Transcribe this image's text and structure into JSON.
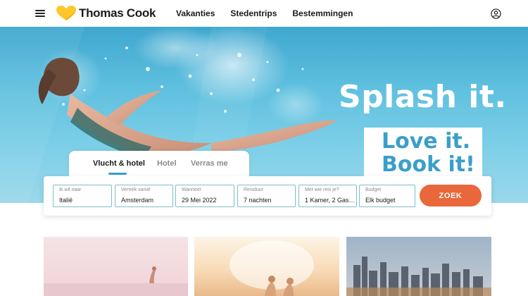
{
  "header": {
    "brand": "Thomas Cook",
    "nav": [
      "Vakanties",
      "Stedentrips",
      "Bestemmingen"
    ]
  },
  "hero": {
    "headline": "Splash it.",
    "subline_1": "Love it.",
    "subline_2": "Book it!"
  },
  "tabs": {
    "items": [
      "Vlucht & hotel",
      "Hotel",
      "Verras me"
    ],
    "active": "Vlucht & hotel"
  },
  "search": {
    "fields": [
      {
        "label": "Ik wil naar",
        "value": "Italië"
      },
      {
        "label": "Vertrek vanaf",
        "value": "Amsterdam"
      },
      {
        "label": "Wanneer",
        "value": "29 Mei 2022"
      },
      {
        "label": "Reisduur",
        "value": "7 nachten"
      },
      {
        "label": "Met wie reis je?",
        "value": "1 Kamer, 2 Gas…"
      },
      {
        "label": "Budget",
        "value": "Elk budget"
      }
    ],
    "button": "ZOEK"
  },
  "colors": {
    "accent_orange": "#e9673a",
    "brand_blue": "#3a9fc8",
    "logo_yellow": "#ffc72c"
  }
}
